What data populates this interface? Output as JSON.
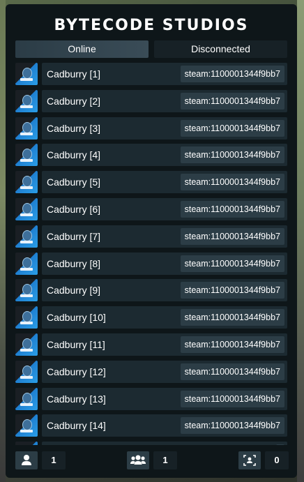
{
  "header": {
    "title": "BYTECODE STUDIOS"
  },
  "tabs": [
    {
      "label": "Online",
      "active": true
    },
    {
      "label": "Disconnected",
      "active": false
    }
  ],
  "players": [
    {
      "name": "Cadburry [1]",
      "steam": "steam:1100001344f9bb7"
    },
    {
      "name": "Cadburry [2]",
      "steam": "steam:1100001344f9bb7"
    },
    {
      "name": "Cadburry [3]",
      "steam": "steam:1100001344f9bb7"
    },
    {
      "name": "Cadburry [4]",
      "steam": "steam:1100001344f9bb7"
    },
    {
      "name": "Cadburry [5]",
      "steam": "steam:1100001344f9bb7"
    },
    {
      "name": "Cadburry [6]",
      "steam": "steam:1100001344f9bb7"
    },
    {
      "name": "Cadburry [7]",
      "steam": "steam:1100001344f9bb7"
    },
    {
      "name": "Cadburry [8]",
      "steam": "steam:1100001344f9bb7"
    },
    {
      "name": "Cadburry [9]",
      "steam": "steam:1100001344f9bb7"
    },
    {
      "name": "Cadburry [10]",
      "steam": "steam:1100001344f9bb7"
    },
    {
      "name": "Cadburry [11]",
      "steam": "steam:1100001344f9bb7"
    },
    {
      "name": "Cadburry [12]",
      "steam": "steam:1100001344f9bb7"
    },
    {
      "name": "Cadburry [13]",
      "steam": "steam:1100001344f9bb7"
    },
    {
      "name": "Cadburry [14]",
      "steam": "steam:1100001344f9bb7"
    },
    {
      "name": "",
      "steam": ""
    }
  ],
  "footer": {
    "player_icon": "user-icon",
    "player_count": "1",
    "group_icon": "users-group-icon",
    "group_count": "1",
    "scan_icon": "face-scan-icon",
    "scan_count": "0"
  },
  "colors": {
    "panel": "#0e1619",
    "row": "#1c2a31",
    "badge": "#2c3d46",
    "avatar_accent": "#2a9ee8"
  }
}
